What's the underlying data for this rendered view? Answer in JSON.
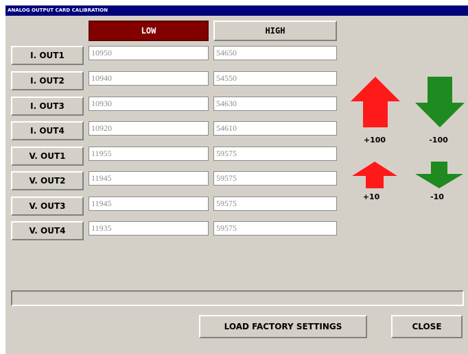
{
  "window": {
    "title": "ANALOG OUTPUT CARD CALIBRATION"
  },
  "columns": {
    "low": "LOW",
    "high": "HIGH"
  },
  "rows": [
    {
      "label": "I. OUT1",
      "low": "10950",
      "high": "54650"
    },
    {
      "label": "I. OUT2",
      "low": "10940",
      "high": "54550"
    },
    {
      "label": "I. OUT3",
      "low": "10930",
      "high": "54630"
    },
    {
      "label": "I. OUT4",
      "low": "10920",
      "high": "54610"
    },
    {
      "label": "V. OUT1",
      "low": "11955",
      "high": "59575"
    },
    {
      "label": "V. OUT2",
      "low": "11945",
      "high": "59575"
    },
    {
      "label": "V. OUT3",
      "low": "11945",
      "high": "59575"
    },
    {
      "label": "V. OUT4",
      "low": "11935",
      "high": "59575"
    }
  ],
  "adjust": {
    "large_up": {
      "label": "+100",
      "icon": "arrow-up-large-icon",
      "color": "#ff1a1a"
    },
    "large_down": {
      "label": "-100",
      "icon": "arrow-down-large-icon",
      "color": "#1f8a1f"
    },
    "small_up": {
      "label": "+10",
      "icon": "arrow-up-small-icon",
      "color": "#ff1a1a"
    },
    "small_down": {
      "label": "-10",
      "icon": "arrow-down-small-icon",
      "color": "#1f8a1f"
    }
  },
  "progress": {
    "value": 0
  },
  "footer": {
    "load_label": "LOAD FACTORY SETTINGS",
    "close_label": "CLOSE"
  },
  "colors": {
    "title_bar": "#00007b",
    "low_header": "#820000",
    "panel": "#d4d0c8"
  }
}
